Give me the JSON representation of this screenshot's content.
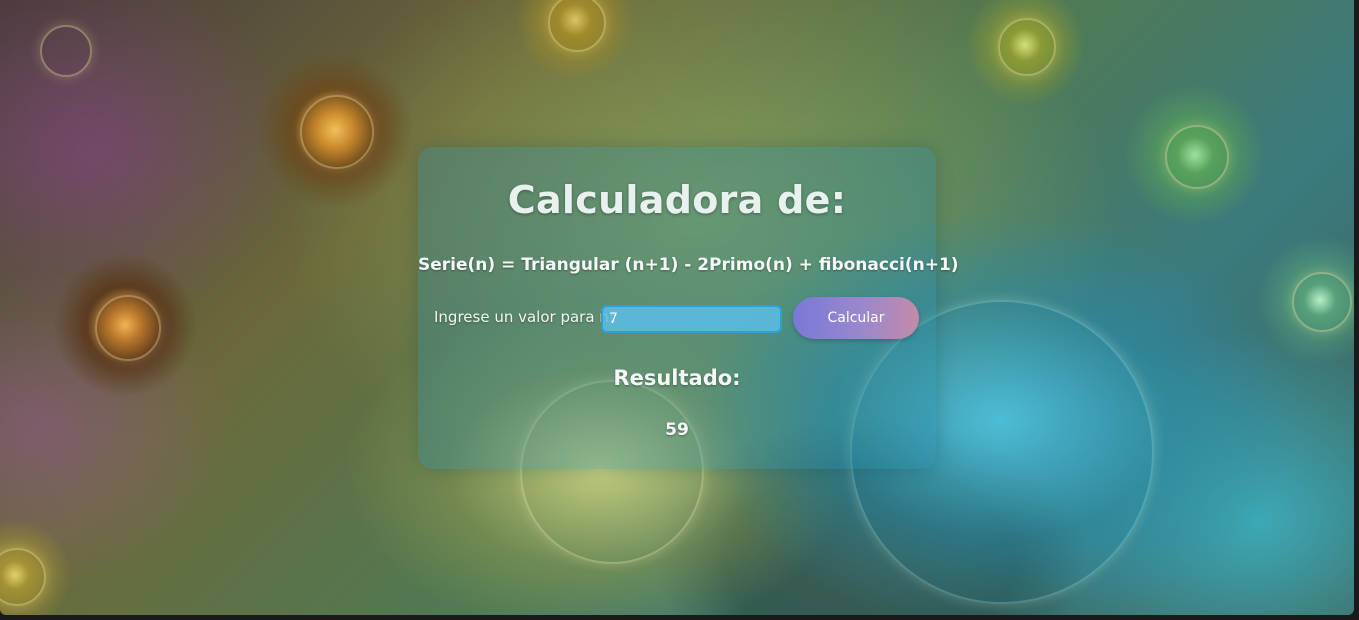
{
  "background": {
    "description_icon": "fractal-spiral-background",
    "colors": {
      "teal": "#3b9fb8",
      "gold": "#c9892c",
      "olive": "#6b6a3a",
      "purple": "#6b4a6b"
    }
  },
  "card": {
    "title": "Calculadora de:",
    "formula": "Serie(n) = Triangular (n+1) - 2Primo(n) + fibonacci(n+1)",
    "input": {
      "label": "Ingrese un valor para n:",
      "value": "7",
      "placeholder": ""
    },
    "button": {
      "label": "Calcular"
    },
    "result": {
      "heading": "Resultado:",
      "value": "59"
    },
    "colors": {
      "panel": "#2c8caa",
      "input_border": "#2f9fd8",
      "button_start": "#7b78d8",
      "button_end": "#c48aa8",
      "text": "#f3f7f6"
    }
  }
}
